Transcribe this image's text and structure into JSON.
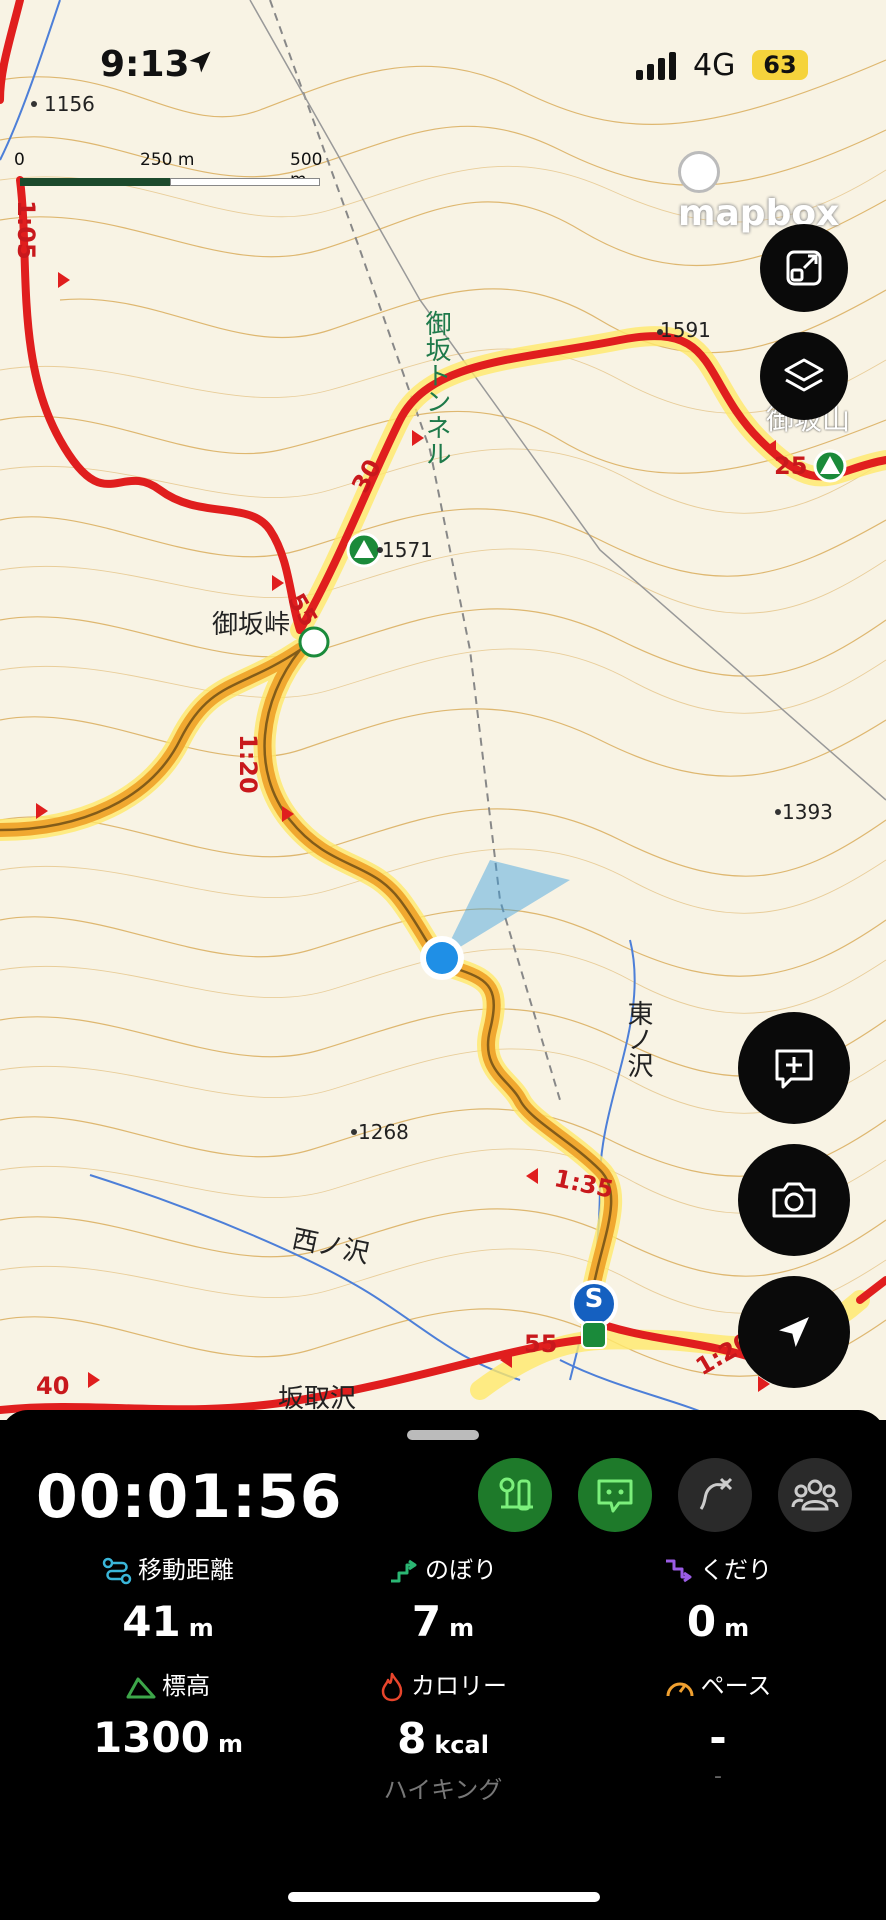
{
  "status_bar": {
    "time": "9:13",
    "network": "4G",
    "battery": "63"
  },
  "map": {
    "attribution": "mapbox",
    "scale": {
      "zero": "0",
      "mid": "250 m",
      "max": "500 m"
    },
    "labels": {
      "elev_1156": "1156",
      "elev_1591": "1591",
      "elev_1571": "1571",
      "elev_1393": "1393",
      "elev_1268": "1268",
      "time_105": "1:05",
      "time_30": "30",
      "time_55a": "55",
      "time_120a": "1:20",
      "time_25": "25",
      "time_135": "1:35",
      "time_55b": "55",
      "time_120b": "1:20",
      "time_40": "40",
      "misaka_pass": "御坂峠",
      "misaka_tunnel": "御坂トンネル",
      "higashi_sawa": "東ノ沢",
      "nishi_sawa": "西ノ沢",
      "itatori_sawa": "坂取沢",
      "peak_partial": "御坂山"
    },
    "start_marker": "S"
  },
  "panel": {
    "timer": "00:01:56",
    "stats": {
      "distance": {
        "label": "移動距離",
        "value": "41",
        "unit": "m"
      },
      "ascent": {
        "label": "のぼり",
        "value": "7",
        "unit": "m"
      },
      "descent": {
        "label": "くだり",
        "value": "0",
        "unit": "m"
      },
      "elevation": {
        "label": "標高",
        "value": "1300",
        "unit": "m"
      },
      "calories": {
        "label": "カロリー",
        "value": "8",
        "unit": "kcal"
      },
      "pace": {
        "label": "ペース",
        "value": "-",
        "sub": "-"
      }
    },
    "activity": "ハイキング",
    "icons": [
      "route-planner-icon",
      "chat-icon",
      "course-off-icon",
      "group-icon"
    ],
    "colors": {
      "accent_green": "#1ea33a",
      "distance": "#3ab6d9",
      "ascent": "#2bb673",
      "descent": "#9b5de5",
      "elevation": "#3da64a",
      "calories": "#e8452c",
      "pace": "#f0a030"
    }
  }
}
